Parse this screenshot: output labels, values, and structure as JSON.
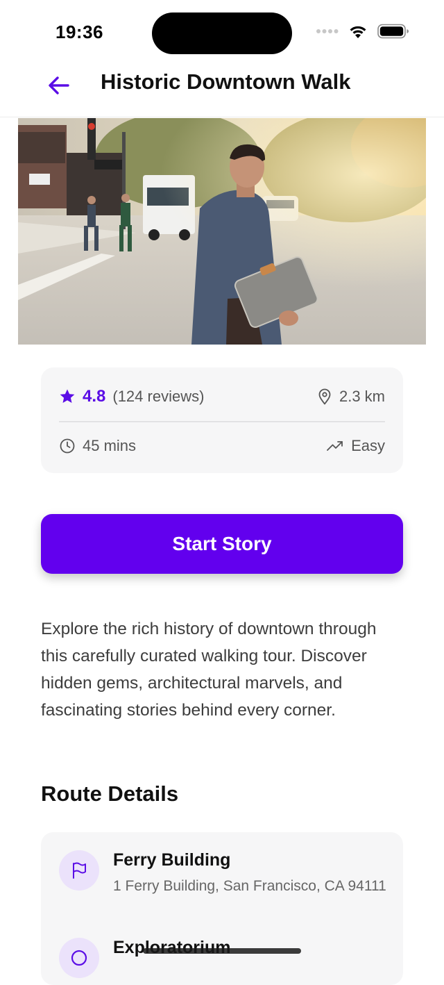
{
  "status_bar": {
    "time": "19:36"
  },
  "nav": {
    "back_icon": "arrow-left-icon",
    "title": "Historic Downtown Walk"
  },
  "hero": {
    "description": "Photo of a man in a denim shirt carrying a grey laptop sleeve crossing a sunny downtown street"
  },
  "stats": {
    "rating": "4.8",
    "reviews": "(124 reviews)",
    "distance": "2.3 km",
    "duration": "45 mins",
    "difficulty": "Easy"
  },
  "start_button": {
    "label": "Start Story"
  },
  "description": "Explore the rich history of downtown through this carefully curated walking tour. Discover hidden gems, architectural marvels, and fascinating stories behind every corner.",
  "route": {
    "title": "Route Details",
    "stops": [
      {
        "name": "Ferry Building",
        "address": "1 Ferry Building, San Francisco, CA 94111",
        "icon": "flag-icon"
      },
      {
        "name": "Exploratorium",
        "address": "",
        "icon": "circle-icon"
      }
    ]
  },
  "colors": {
    "accent": "#6200ee",
    "card_bg": "#f6f6f7",
    "icon_bg": "#ebe2fb"
  }
}
